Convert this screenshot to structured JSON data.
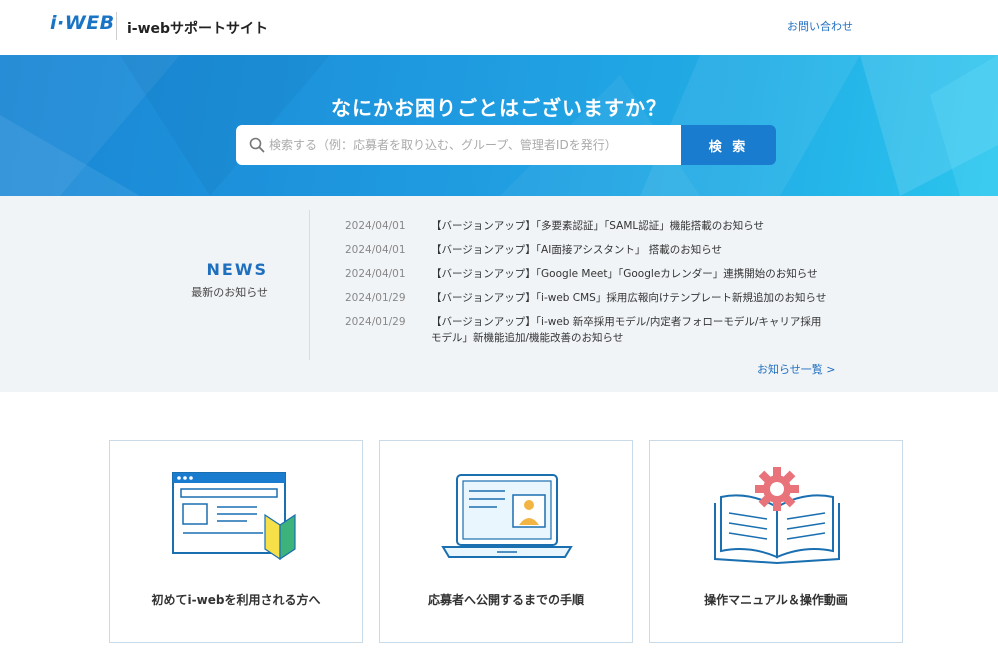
{
  "header": {
    "logo": "i·WEB",
    "site_title": "i-webサポートサイト",
    "contact_link": "お問い合わせ"
  },
  "hero": {
    "title": "なにかお困りごとはございますか？",
    "search_placeholder": "検索する（例：応募者を取り込む、グループ、管理者IDを発行）",
    "search_value": "",
    "search_button": "検 索"
  },
  "news": {
    "heading": "NEWS",
    "subheading": "最新のお知らせ",
    "items": [
      {
        "date": "2024/04/01",
        "title": "【バージョンアップ】「多要素認証」「SAML認証」機能搭載のお知らせ"
      },
      {
        "date": "2024/04/01",
        "title": "【バージョンアップ】「AI面接アシスタント」 搭載のお知らせ"
      },
      {
        "date": "2024/04/01",
        "title": "【バージョンアップ】「Google Meet」「Googleカレンダー」連携開始のお知らせ"
      },
      {
        "date": "2024/01/29",
        "title": "【バージョンアップ】「i-web CMS」採用広報向けテンプレート新規追加のお知らせ"
      },
      {
        "date": "2024/01/29",
        "title": "【バージョンアップ】「i-web 新卒採用モデル/内定者フォローモデル/キャリア採用モデル」新機能追加/機能改善のお知らせ"
      }
    ],
    "more_link": "お知らせ一覧 >"
  },
  "cards": [
    {
      "label": "初めてi-webを利用される方へ",
      "icon": "browser-beginner-icon"
    },
    {
      "label": "応募者へ公開するまでの手順",
      "icon": "laptop-profile-icon"
    },
    {
      "label": "操作マニュアル＆操作動画",
      "icon": "manual-gear-icon"
    }
  ],
  "colors": {
    "brand_blue": "#1a74c4",
    "hero_gradient_start": "#1a86d4",
    "hero_gradient_end": "#2bc5ee",
    "news_background": "#f1f4f7",
    "link_blue": "#1f6fbf"
  }
}
